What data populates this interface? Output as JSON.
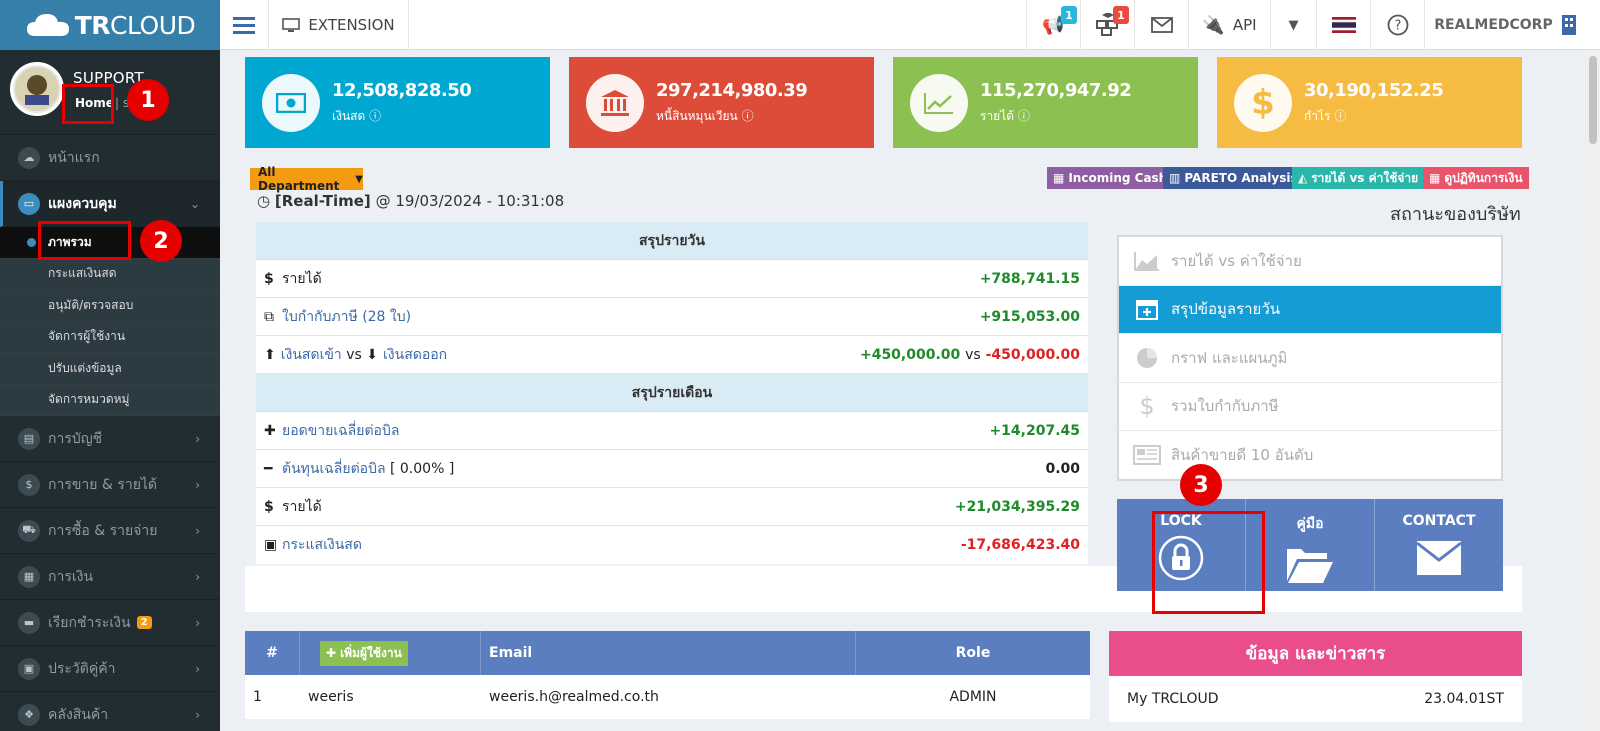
{
  "brand": {
    "bold": "TR",
    "light": "CLOUD"
  },
  "topbar": {
    "extension_label": "EXTENSION",
    "notif_badge_1": "1",
    "notif_badge_2": "1",
    "api_label": "API",
    "company_name": "REALMEDCORP"
  },
  "sidebar": {
    "user_name": "SUPPORT",
    "home_link": "Home",
    "online_text": "| s",
    "items": [
      {
        "label": "หน้าแรก"
      },
      {
        "label": "แผงควบคุม"
      },
      {
        "label": "การบัญชี"
      },
      {
        "label": "การขาย & รายได้"
      },
      {
        "label": "การซื้อ & รายจ่าย"
      },
      {
        "label": "การเงิน"
      },
      {
        "label": "เรียกชำระเงิน",
        "badge": "2"
      },
      {
        "label": "ประวัติคู่ค้า"
      },
      {
        "label": "คลังสินค้า"
      }
    ],
    "subitems": [
      {
        "label": "ภาพรวม"
      },
      {
        "label": "กระแสเงินสด"
      },
      {
        "label": "อนุมัติ/ตรวจสอบ"
      },
      {
        "label": "จัดการผู้ใช้งาน"
      },
      {
        "label": "ปรับแต่งข้อมูล"
      },
      {
        "label": "จัดการหมวดหมู่"
      }
    ]
  },
  "kpis": [
    {
      "value": "12,508,828.50",
      "label": "เงินสด",
      "color": "#00a7d0"
    },
    {
      "value": "297,214,980.39",
      "label": "หนี้สินหมุนเวียน",
      "color": "#dd4b39"
    },
    {
      "value": "115,270,947.92",
      "label": "รายได้",
      "color": "#8cc152"
    },
    {
      "value": "30,190,152.25",
      "label": "กำไร",
      "color": "#f6bb42"
    }
  ],
  "toolbar": {
    "department": "All Department",
    "buttons": [
      {
        "label": "Incoming Cash",
        "color": "#8e5ea2"
      },
      {
        "label": "PARETO Analysis",
        "color": "#3c5a9a"
      },
      {
        "label": "รายได้ vs ค่าใช้จ่าย",
        "color": "#2ab7a9"
      },
      {
        "label": "ดูปฏิทินการเงิน",
        "color": "#e9546b"
      }
    ]
  },
  "realtime": {
    "label": "[Real-Time]",
    "at": "@",
    "datetime": "19/03/2024 - 10:31:08"
  },
  "company_status": "สถานะของบริษัท",
  "daily": {
    "title": "สรุปรายวัน",
    "income_label": "รายได้",
    "income_value": "+788,741.15",
    "tax_label": "ใบกำกับภาษี (28 ใบ)",
    "tax_value": "+915,053.00",
    "cash_in_label": "เงินสดเข้า",
    "vs": "vs",
    "cash_out_label": "เงินสดออก",
    "cash_in_value": "+450,000.00",
    "cash_out_value": "-450,000.00"
  },
  "monthly": {
    "title": "สรุปรายเดือน",
    "avg_sale_label": "ยอดขายเฉลี่ยต่อบิล",
    "avg_sale_value": "+14,207.45",
    "avg_cost_label": "ต้นทุนเฉลี่ยต่อบิล",
    "avg_cost_pct": "[ 0.00% ]",
    "avg_cost_value": "0.00",
    "income_label": "รายได้",
    "income_value": "+21,034,395.29",
    "cashflow_label": "กระแสเงินสด",
    "cashflow_value": "-17,686,423.40"
  },
  "rpanel": [
    {
      "label": "รายได้ vs ค่าใช้จ่าย"
    },
    {
      "label": "สรุปข้อมูลรายวัน"
    },
    {
      "label": "กราฟ และแผนภูมิ"
    },
    {
      "label": "รวมใบกำกับภาษี"
    },
    {
      "label": "สินค้าขายดี 10 อันดับ"
    }
  ],
  "quick": {
    "lock": "LOCK",
    "manual": "คู่มือ",
    "contact": "CONTACT"
  },
  "users": {
    "headers": {
      "num": "#",
      "add_button": "เพิ่มผู้ใช้งาน",
      "email": "Email",
      "role": "Role"
    },
    "rows": [
      {
        "num": "1",
        "name": "weeris",
        "email": "weeris.h@realmed.co.th",
        "role": "ADMIN"
      }
    ]
  },
  "info": {
    "title": "ข้อมูล และข่าวสาร",
    "row_label": "My TRCLOUD",
    "row_value": "23.04.01ST"
  },
  "annotations": [
    "1",
    "2",
    "3"
  ]
}
